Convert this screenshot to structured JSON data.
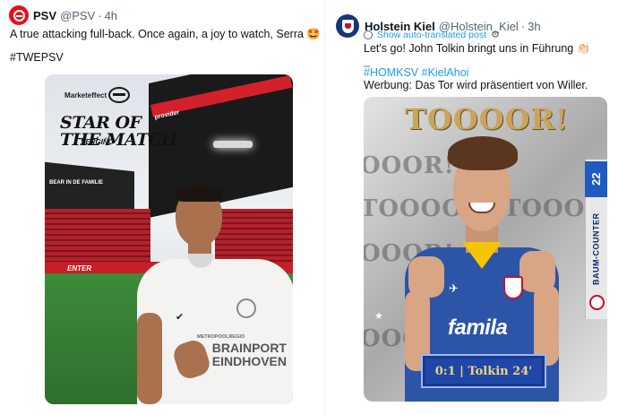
{
  "posts": [
    {
      "display_name": "PSV",
      "handle": "@PSV",
      "time": "4h",
      "avatar_icon": "psv-logo-icon",
      "text_line1": "A true attacking full-back. Once again, a joy to watch, Serra 🤩",
      "hashtag": "#TWEPSV",
      "media": {
        "brand": "Marketeffect",
        "title_line1": "STAR OF",
        "title_line2": "THE MATCH",
        "player": "SERGIÑO",
        "hoarding_top": "BEAR IN DE FAMILIE",
        "hoarding_bottom": "ENTER",
        "roof_ad": "provider",
        "shirt_sponsor_top": "METROPOOLREGIO",
        "shirt_sponsor_line1": "BRAINPORT",
        "shirt_sponsor_line2": "EINDHOVEN"
      }
    },
    {
      "display_name": "Holstein Kiel",
      "handle": "@Holstein_Kiel",
      "time": "3h",
      "avatar_icon": "holstein-kiel-crest-icon",
      "translate_label": "Show auto-translated post",
      "text_line1": "Let's go! John Tolkin bringt uns in Führung 👏🏻",
      "separator": "_",
      "hashtag1": "#HOMKSV",
      "hashtag2": "#KielAhoi",
      "text_line3": "Werbung: Das Tor wird präsentiert von Willer.",
      "media": {
        "headline": "TOOOOR!",
        "background_word": "TOOOOR! TOOOOR!",
        "background_fragment": "OOOR!",
        "shirt_number": "22",
        "side_text": "BAUM-COUNTER",
        "shirt_sponsor": "famila",
        "score_line": "0:1 | Tolkin 24'"
      }
    }
  ]
}
